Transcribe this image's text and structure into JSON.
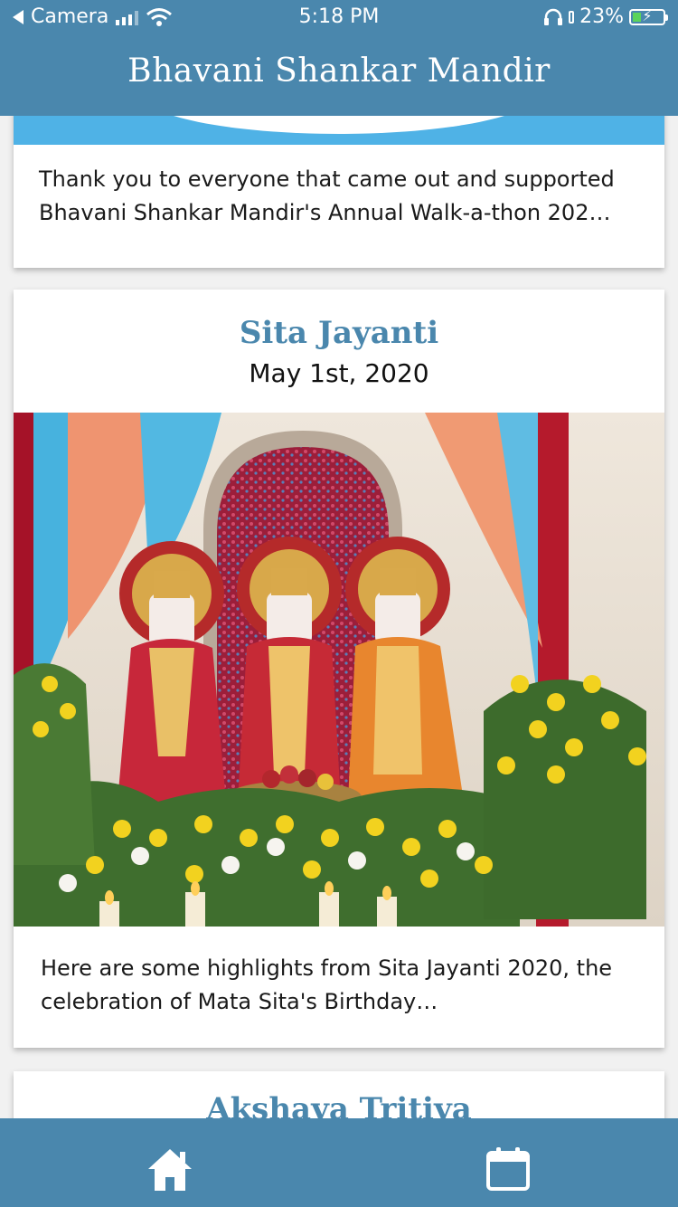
{
  "status_bar": {
    "back_app": "Camera",
    "time": "5:18 PM",
    "battery": "23%",
    "signal_icon": "cellular-signal-icon",
    "wifi_icon": "wifi-icon",
    "headphones_icon": "headphones-icon",
    "battery_icon": "battery-charging-icon"
  },
  "header": {
    "title": "Bhavani Shankar Mandir"
  },
  "posts": [
    {
      "text": "Thank you to everyone that came out and supported Bhavani Shankar Mandir's Annual Walk-a-thon 202…"
    },
    {
      "title": "Sita Jayanti",
      "date": "May 1st, 2020",
      "image": "altar-deities-photo",
      "text": "Here are some highlights from Sita Jayanti 2020, the celebration of Mata Sita's Birthday…"
    },
    {
      "title": "Akshaya Tritiya"
    }
  ],
  "tab_bar": {
    "items": [
      {
        "icon": "home-icon"
      },
      {
        "icon": "calendar-icon"
      }
    ]
  },
  "colors": {
    "primary": "#4a87ad",
    "accent_blue": "#4fb2e6",
    "battery_green": "#5bd45b"
  }
}
